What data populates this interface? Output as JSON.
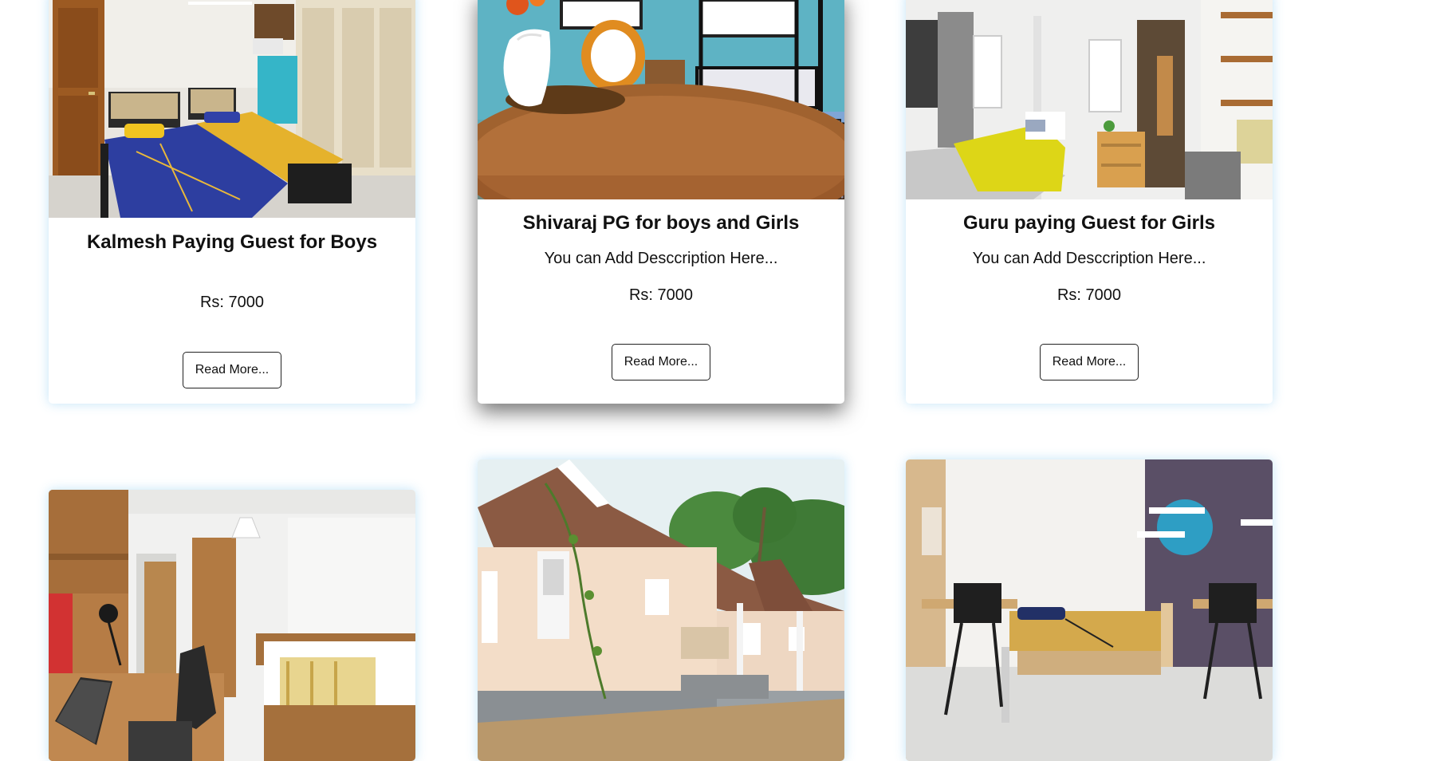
{
  "cards": [
    {
      "title": "Kalmesh Paying Guest for Boys",
      "description": "",
      "price": "Rs: 7000",
      "button": "Read More...",
      "image": "twin-beds-room-photo"
    },
    {
      "title": "Shivaraj PG for boys and Girls",
      "description": "You can Add Desccription Here...",
      "price": "Rs: 7000",
      "button": "Read More...",
      "image": "bunk-beds-room-photo"
    },
    {
      "title": "Guru paying Guest for Girls",
      "description": "You can Add Desccription Here...",
      "price": "Rs: 7000",
      "button": "Read More...",
      "image": "single-bed-room-photo"
    },
    {
      "title": "",
      "description": "",
      "price": "",
      "button": "",
      "image": "study-room-photo"
    },
    {
      "title": "",
      "description": "",
      "price": "",
      "button": "",
      "image": "house-exterior-photo"
    },
    {
      "title": "",
      "description": "",
      "price": "",
      "button": "",
      "image": "modern-room-photo"
    }
  ]
}
